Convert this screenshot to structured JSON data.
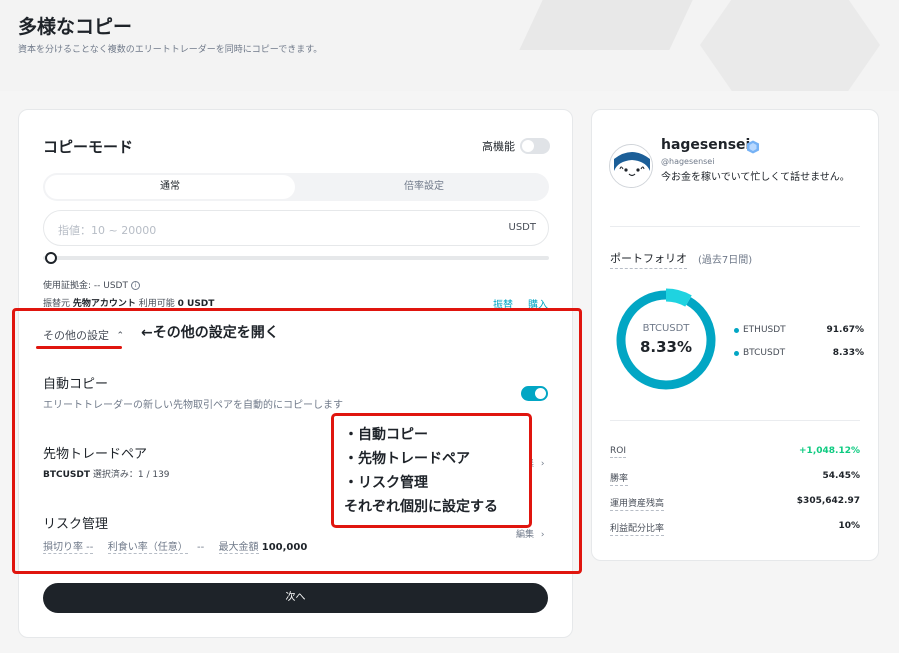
{
  "hero": {
    "title": "多様なコピー",
    "subtitle": "資本を分けることなく複数のエリートトレーダーを同時にコピーできます。"
  },
  "copy_mode": {
    "title": "コピーモード",
    "advanced_label": "高機能",
    "advanced_enabled": false,
    "tabs": [
      {
        "label": "通常",
        "active": true
      },
      {
        "label": "倍率設定",
        "active": false
      }
    ],
    "amount_input": {
      "placeholder": "指値：10 ~ 20000",
      "value": "",
      "unit": "USDT"
    },
    "slider_percent": 0,
    "margin_used": "使用証拠金: -- USDT",
    "source_prefix": "振替元 ",
    "source_account": "先物アカウント",
    "available": " 利用可能 ",
    "available_value": "0 USDT",
    "transfer_link": "振替",
    "buy_link": "購入"
  },
  "other_settings": {
    "label": "その他の設定",
    "chevron": "^",
    "annotation": "←その他の設定を開く"
  },
  "auto_copy": {
    "title": "自動コピー",
    "description": "エリートトレーダーの新しい先物取引ペアを自動的にコピーします",
    "enabled": true
  },
  "futures_pair": {
    "title": "先物トレードペア",
    "pair": "BTCUSDT",
    "selected_text": " 選択済み：1 / 139",
    "edit_label": "編集"
  },
  "risk": {
    "title": "リスク管理",
    "stop_loss": "損切り率 --",
    "take_profit": "利食い率（任意）",
    "tp_value": "--",
    "max_amount_label": "最大金額",
    "max_amount_value": "100,000",
    "edit_label": "編集"
  },
  "note": {
    "lines": [
      "・自動コピー",
      "・先物トレードペア",
      "・リスク管理",
      "それぞれ個別に設定する"
    ]
  },
  "next_button": "次へ",
  "trader": {
    "name": "hagesensei",
    "handle": "@hagesensei",
    "bio": "今お金を稼いでいて忙しくて話せません。",
    "verified_color": "#76b2f5"
  },
  "portfolio": {
    "title": "ポートフォリオ",
    "period": "(過去7日間)",
    "center_label": "BTCUSDT",
    "center_value": "8.33%",
    "accent": "#02a6c4",
    "accent_light": "#1fd3e0"
  },
  "chart_data": {
    "type": "pie",
    "categories": [
      "ETHUSDT",
      "BTCUSDT"
    ],
    "values": [
      91.67,
      8.33
    ],
    "labels": [
      "91.67%",
      "8.33%"
    ]
  },
  "stats": [
    {
      "label": "ROI",
      "value": "+1,048.12%",
      "positive": true
    },
    {
      "label": "勝率",
      "value": "54.45%"
    },
    {
      "label": "運用資産残高",
      "value": "$305,642.97"
    },
    {
      "label": "利益配分比率",
      "value": "10%"
    }
  ]
}
